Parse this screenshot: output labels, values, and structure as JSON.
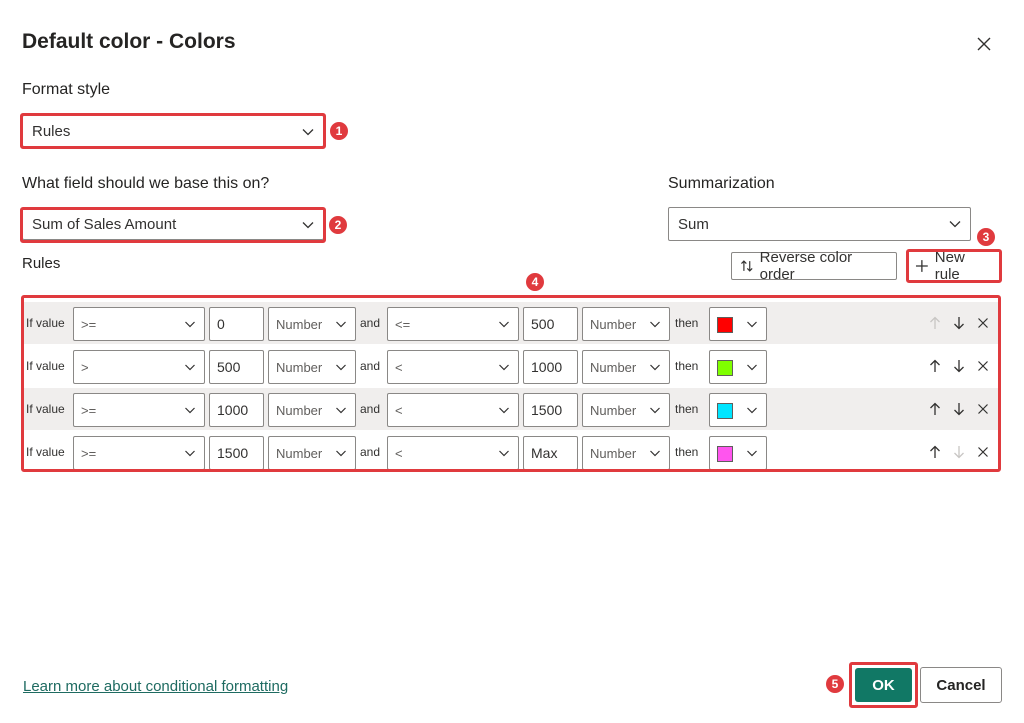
{
  "dialog": {
    "title": "Default color - Colors"
  },
  "format_style": {
    "label": "Format style",
    "value": "Rules"
  },
  "base_field": {
    "label": "What field should we base this on?",
    "value": "Sum of Sales Amount"
  },
  "summarization": {
    "label": "Summarization",
    "value": "Sum"
  },
  "rules_section": {
    "label": "Rules",
    "reverse_label": "Reverse color order",
    "new_rule_label": "New rule"
  },
  "rules": [
    {
      "if_text": "If value",
      "op1": ">=",
      "val1": "0",
      "type1": "Number",
      "and_text": "and",
      "op2": "<=",
      "val2": "500",
      "type2": "Number",
      "then_text": "then",
      "color": "#ff0000",
      "up_enabled": false,
      "down_enabled": true
    },
    {
      "if_text": "If value",
      "op1": ">",
      "val1": "500",
      "type1": "Number",
      "and_text": "and",
      "op2": "<",
      "val2": "1000",
      "type2": "Number",
      "then_text": "then",
      "color": "#7fff00",
      "up_enabled": true,
      "down_enabled": true
    },
    {
      "if_text": "If value",
      "op1": ">=",
      "val1": "1000",
      "type1": "Number",
      "and_text": "and",
      "op2": "<",
      "val2": "1500",
      "type2": "Number",
      "then_text": "then",
      "color": "#00e5ff",
      "up_enabled": true,
      "down_enabled": true
    },
    {
      "if_text": "If value",
      "op1": ">=",
      "val1": "1500",
      "type1": "Number",
      "and_text": "and",
      "op2": "<",
      "val2": "Max",
      "type2": "Number",
      "then_text": "then",
      "color": "#ff55ee",
      "up_enabled": true,
      "down_enabled": false
    }
  ],
  "annotations": [
    "1",
    "2",
    "3",
    "4",
    "5"
  ],
  "footer": {
    "learn_more": "Learn more about conditional formatting",
    "ok_label": "OK",
    "cancel_label": "Cancel"
  },
  "colors": {
    "accent": "#117865",
    "highlight": "#e03a3e",
    "link": "#1e6b61"
  },
  "icons": {
    "close": "close-icon",
    "chevron": "chevron-down-icon",
    "reverse": "sort-arrows-icon",
    "add": "plus-icon",
    "up": "arrow-up-icon",
    "down": "arrow-down-icon",
    "delete": "close-icon"
  }
}
